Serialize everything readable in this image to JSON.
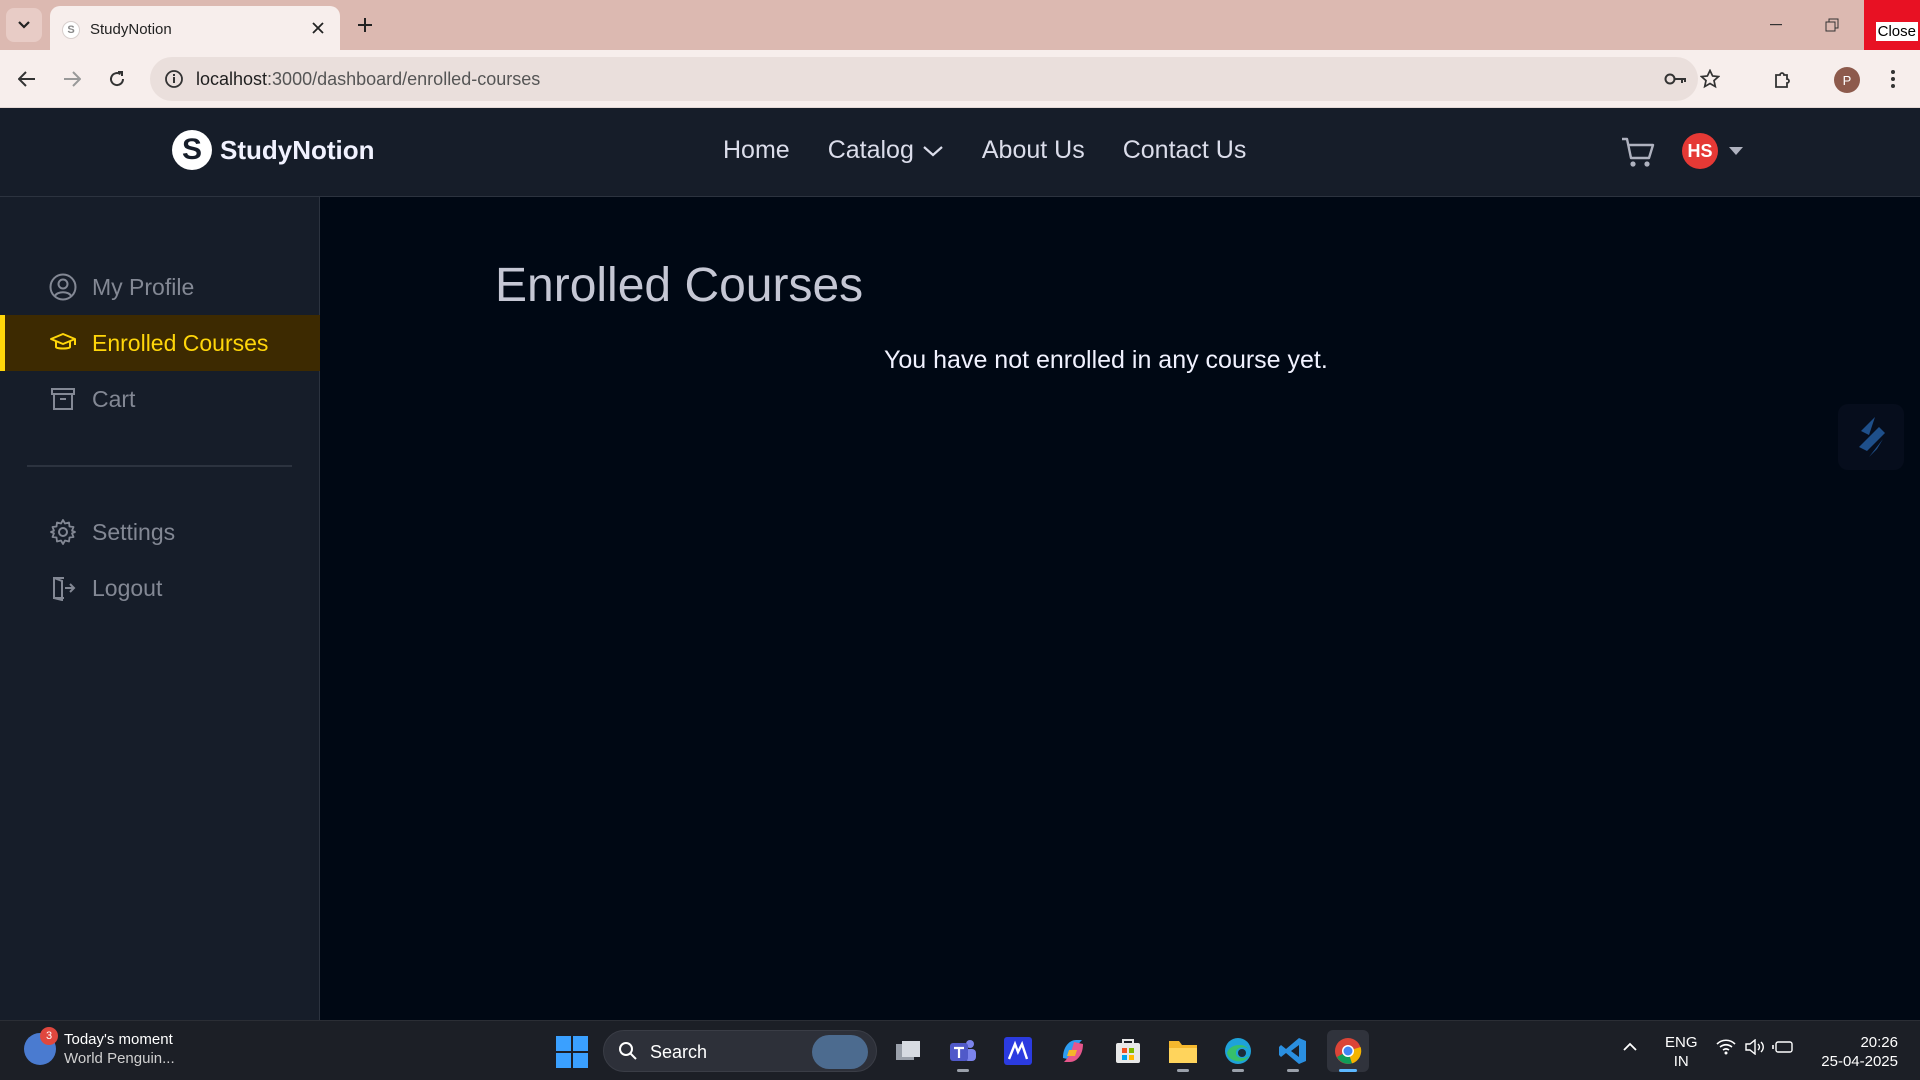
{
  "browser": {
    "tab_title": "StudyNotion",
    "tab_favicon_letter": "S",
    "url_host": "localhost",
    "url_path": ":3000/dashboard/enrolled-courses",
    "profile_initial": "P",
    "close_tooltip": "Close"
  },
  "app": {
    "logo_letter": "S",
    "logo_text": "StudyNotion",
    "nav": {
      "home": "Home",
      "catalog": "Catalog",
      "about": "About Us",
      "contact": "Contact Us"
    },
    "avatar_initials": "HS",
    "accent_color": "#ffd60a"
  },
  "sidebar": {
    "items": [
      {
        "label": "My Profile",
        "icon": "user-circle-icon"
      },
      {
        "label": "Enrolled Courses",
        "icon": "graduation-cap-icon",
        "active": true
      },
      {
        "label": "Cart",
        "icon": "archive-box-icon"
      },
      {
        "label": "Settings",
        "icon": "gear-icon"
      },
      {
        "label": "Logout",
        "icon": "logout-icon"
      }
    ]
  },
  "main": {
    "title": "Enrolled Courses",
    "empty_message": "You have not enrolled in any course yet."
  },
  "taskbar": {
    "weather_badge": "3",
    "weather_title": "Today's moment",
    "weather_sub": "World Penguin...",
    "search_label": "Search",
    "lang_1": "ENG",
    "lang_2": "IN",
    "time": "20:26",
    "date": "25-04-2025"
  }
}
